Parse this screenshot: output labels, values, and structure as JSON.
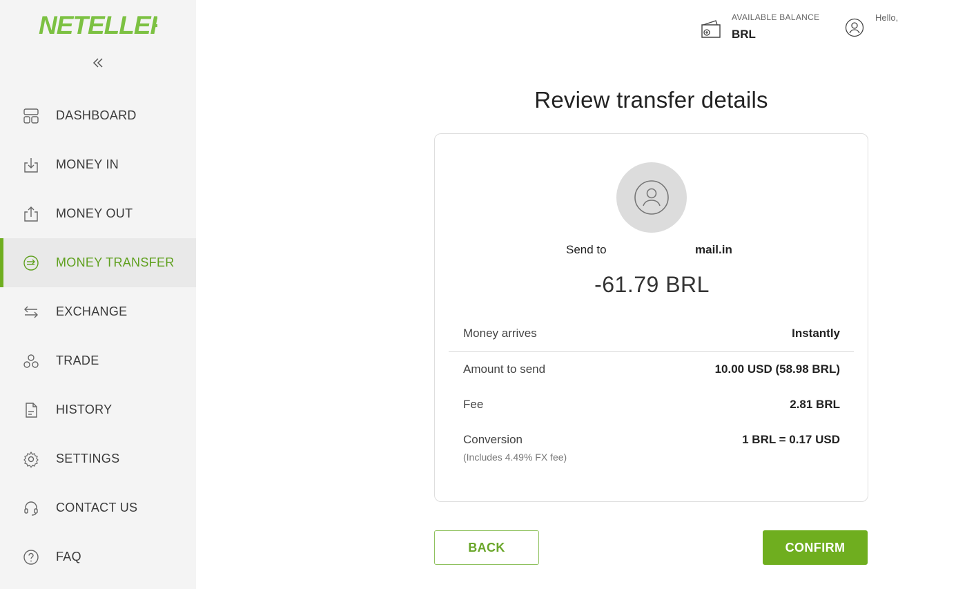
{
  "brand": {
    "name": "NETELLER",
    "accent_color": "#6fae1f"
  },
  "sidebar": {
    "collapse_icon": "double-chevron-left-icon",
    "items": [
      {
        "label": "DASHBOARD",
        "icon": "dashboard-icon",
        "active": false
      },
      {
        "label": "MONEY IN",
        "icon": "money-in-icon",
        "active": false
      },
      {
        "label": "MONEY OUT",
        "icon": "money-out-icon",
        "active": false
      },
      {
        "label": "MONEY TRANSFER",
        "icon": "money-transfer-icon",
        "active": true
      },
      {
        "label": "EXCHANGE",
        "icon": "exchange-icon",
        "active": false
      },
      {
        "label": "TRADE",
        "icon": "trade-icon",
        "active": false
      },
      {
        "label": "HISTORY",
        "icon": "history-icon",
        "active": false
      },
      {
        "label": "SETTINGS",
        "icon": "gear-icon",
        "active": false
      },
      {
        "label": "CONTACT US",
        "icon": "headset-icon",
        "active": false
      },
      {
        "label": "FAQ",
        "icon": "question-icon",
        "active": false
      }
    ]
  },
  "header": {
    "balance_label": "AVAILABLE BALANCE",
    "balance_currency": "BRL",
    "greeting": "Hello,"
  },
  "main": {
    "title": "Review transfer details",
    "send_to_label": "Send to",
    "recipient": "mail.in",
    "total": "-61.79 BRL",
    "rows": [
      {
        "key": "Money arrives",
        "value": "Instantly"
      },
      {
        "key": "Amount to send",
        "value": "10.00 USD (58.98 BRL)"
      },
      {
        "key": "Fee",
        "value": "2.81 BRL"
      },
      {
        "key": "Conversion",
        "value": "1 BRL = 0.17 USD",
        "note": "(Includes 4.49% FX fee)"
      }
    ],
    "back_label": "BACK",
    "confirm_label": "CONFIRM"
  }
}
